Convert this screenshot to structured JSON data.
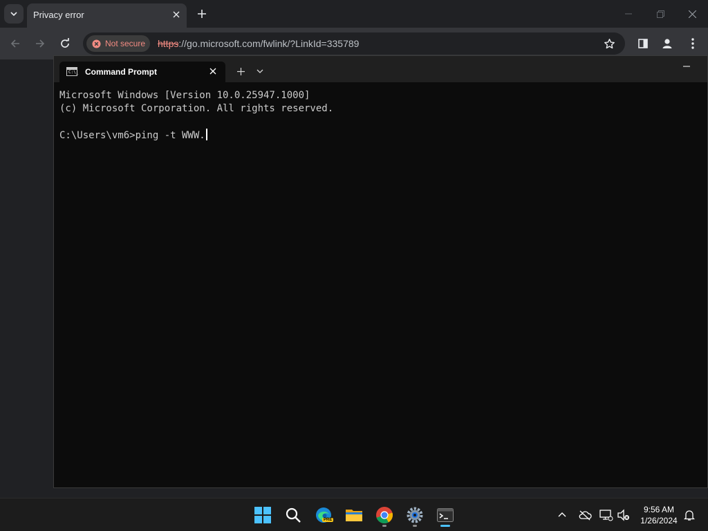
{
  "browser": {
    "tab_title": "Privacy error",
    "security_label": "Not secure",
    "url_scheme": "https",
    "url_rest": "://go.microsoft.com/fwlink/?LinkId=335789"
  },
  "terminal": {
    "tab_title": "Command Prompt",
    "icon_text": "C:\\_",
    "lines": [
      "Microsoft Windows [Version 10.0.25947.1000]",
      "(c) Microsoft Corporation. All rights reserved.",
      "",
      "C:\\Users\\vm6>ping -t WWW."
    ]
  },
  "taskbar": {
    "edge_badge": "PRE",
    "time": "9:56 AM",
    "date": "1/26/2024"
  },
  "colors": {
    "insecure_red": "#f28b82",
    "terminal_bg": "#0c0c0c",
    "win_blue": "#4cc2ff"
  }
}
